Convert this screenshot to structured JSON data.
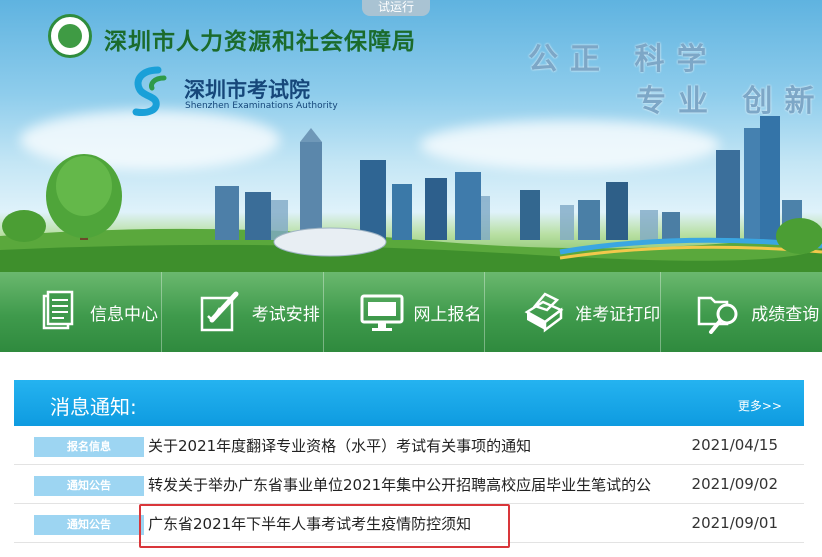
{
  "banner": {
    "trial_tag": "试运行",
    "org_name": "深圳市人力资源和社会保障局",
    "exam_authority_cn": "深圳市考试院",
    "exam_authority_en": "Shenzhen Examinations Authority",
    "slogan_line1": "公正 科学",
    "slogan_line2": "专业 创新"
  },
  "nav": {
    "items": [
      {
        "label": "信息中心",
        "icon": "document-icon"
      },
      {
        "label": "考试安排",
        "icon": "edit-pen-icon"
      },
      {
        "label": "网上报名",
        "icon": "monitor-icon"
      },
      {
        "label": "准考证打印",
        "icon": "printer-icon"
      },
      {
        "label": "成绩查询",
        "icon": "search-folder-icon"
      }
    ]
  },
  "notices": {
    "title": "消息通知:",
    "more_label": "更多>>",
    "rows": [
      {
        "badge": "报名信息",
        "title": "关于2021年度翻译专业资格（水平）考试有关事项的通知",
        "date": "2021/04/15"
      },
      {
        "badge": "通知公告",
        "title": "转发关于举办广东省事业单位2021年集中公开招聘高校应届毕业生笔试的公",
        "date": "2021/09/02"
      },
      {
        "badge": "通知公告",
        "title": "广东省2021年下半年人事考试考生疫情防控须知",
        "date": "2021/09/01"
      }
    ]
  },
  "colors": {
    "nav_green": "#3f9a4c",
    "panel_blue": "#0e9be0",
    "badge_blue": "#9dd5f2",
    "highlight_red": "#d9363a"
  }
}
